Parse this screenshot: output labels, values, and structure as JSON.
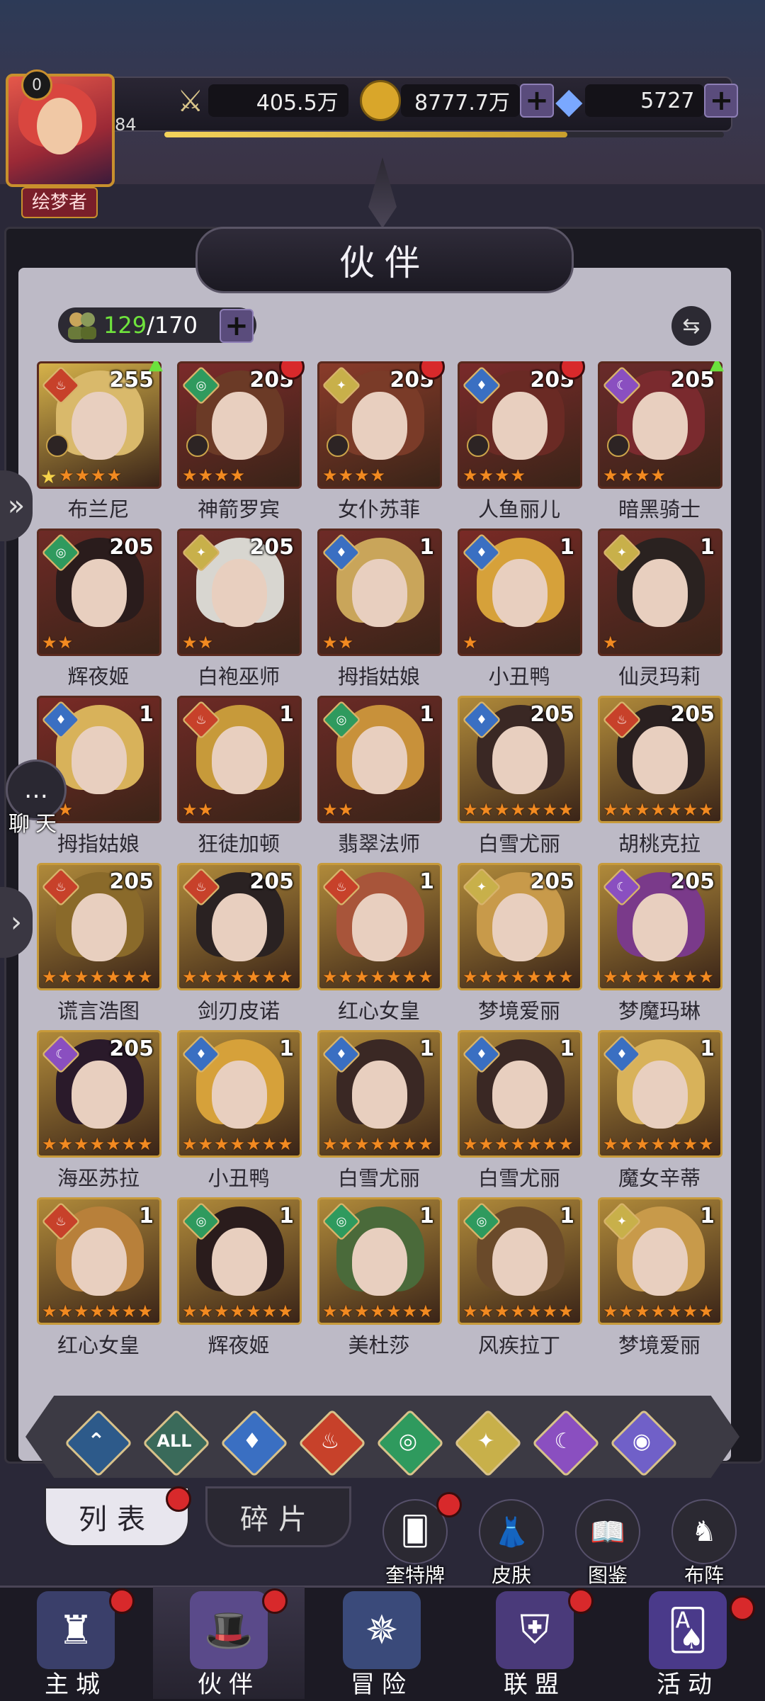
{
  "header": {
    "player_level": "84",
    "vip_level": "0",
    "player_title": "绘梦者",
    "power": "405.5万",
    "gold": "8777.7万",
    "diamonds": "5727",
    "xp_fill_fraction": 0.72
  },
  "panel": {
    "title": "伙伴",
    "count_current": "129",
    "count_total": "/170"
  },
  "heroes": [
    {
      "name": "布兰尼",
      "level": "255",
      "element": "fire",
      "stars": 4,
      "badge": "arrow",
      "lock": true,
      "ystar": true,
      "bg": "#d6b24a",
      "hair": "#d9b96b"
    },
    {
      "name": "神箭罗宾",
      "level": "205",
      "element": "wind",
      "stars": 4,
      "badge": "dot",
      "lock": true,
      "bg": "#7b2a2a",
      "hair": "#6b3a26"
    },
    {
      "name": "女仆苏菲",
      "level": "205",
      "element": "light",
      "stars": 4,
      "badge": "dot",
      "lock": true,
      "bg": "#8a3b2a",
      "hair": "#7a3b28"
    },
    {
      "name": "人鱼丽儿",
      "level": "205",
      "element": "water",
      "stars": 4,
      "badge": "dot",
      "lock": true,
      "bg": "#7a2a2a",
      "hair": "#6a2a24"
    },
    {
      "name": "暗黑骑士",
      "level": "205",
      "element": "dark",
      "stars": 4,
      "badge": "arrow",
      "lock": true,
      "bg": "#6a2a2a",
      "hair": "#7a2a2e"
    },
    {
      "name": "辉夜姬",
      "level": "205",
      "element": "wind",
      "stars": 2,
      "bg": "#6e2a26",
      "hair": "#2a1c1c"
    },
    {
      "name": "白袍巫师",
      "level": "205",
      "element": "light",
      "stars": 2,
      "bg": "#6b2a26",
      "hair": "#d8d6d0"
    },
    {
      "name": "拇指姑娘",
      "level": "1",
      "element": "water",
      "stars": 2,
      "bg": "#6e2a26",
      "hair": "#c9a55a"
    },
    {
      "name": "小丑鸭",
      "level": "1",
      "element": "water",
      "stars": 1,
      "bg": "#7a2a26",
      "hair": "#d6a13a"
    },
    {
      "name": "仙灵玛莉",
      "level": "1",
      "element": "light",
      "stars": 1,
      "bg": "#6b2a26",
      "hair": "#2a2220"
    },
    {
      "name": "拇指姑娘",
      "level": "1",
      "element": "water",
      "stars": 2,
      "bg": "#7a2a26",
      "hair": "#d8b25a"
    },
    {
      "name": "狂徒加顿",
      "level": "1",
      "element": "fire",
      "stars": 2,
      "bg": "#6e2a26",
      "hair": "#c79a3a"
    },
    {
      "name": "翡翠法师",
      "level": "1",
      "element": "wind",
      "stars": 2,
      "bg": "#6a2a26",
      "hair": "#c8913a"
    },
    {
      "name": "白雪尤丽",
      "level": "205",
      "element": "water",
      "stars": 7,
      "bg": "#b08a3a",
      "hair": "#3a2824"
    },
    {
      "name": "胡桃克拉",
      "level": "205",
      "element": "fire",
      "stars": 7,
      "bg": "#b08a3a",
      "hair": "#2a2020"
    },
    {
      "name": "谎言浩图",
      "level": "205",
      "element": "fire",
      "stars": 7,
      "bg": "#b08a3a",
      "hair": "#8a6a2a"
    },
    {
      "name": "剑刃皮诺",
      "level": "205",
      "element": "fire",
      "stars": 7,
      "bg": "#b08a3a",
      "hair": "#2a2222"
    },
    {
      "name": "红心女皇",
      "level": "1",
      "element": "fire",
      "stars": 7,
      "bg": "#b08a3a",
      "hair": "#a8553a"
    },
    {
      "name": "梦境爱丽",
      "level": "205",
      "element": "light",
      "stars": 7,
      "bg": "#b08a3a",
      "hair": "#c89a4a"
    },
    {
      "name": "梦魔玛琳",
      "level": "205",
      "element": "dark",
      "stars": 7,
      "bg": "#b08a3a",
      "hair": "#7a3a8a"
    },
    {
      "name": "海巫苏拉",
      "level": "205",
      "element": "dark",
      "stars": 7,
      "bg": "#b08a3a",
      "hair": "#2a1a2a"
    },
    {
      "name": "小丑鸭",
      "level": "1",
      "element": "water",
      "stars": 7,
      "bg": "#b08a3a",
      "hair": "#d6a13a"
    },
    {
      "name": "白雪尤丽",
      "level": "1",
      "element": "water",
      "stars": 7,
      "bg": "#b08a3a",
      "hair": "#3a2824"
    },
    {
      "name": "白雪尤丽",
      "level": "1",
      "element": "water",
      "stars": 7,
      "bg": "#b08a3a",
      "hair": "#3a2824"
    },
    {
      "name": "魔女辛蒂",
      "level": "1",
      "element": "water",
      "stars": 7,
      "bg": "#b08a3a",
      "hair": "#d8b25a"
    },
    {
      "name": "红心女皇",
      "level": "1",
      "element": "fire",
      "stars": 7,
      "bg": "#b08a3a",
      "hair": "#b8803a"
    },
    {
      "name": "辉夜姬",
      "level": "1",
      "element": "wind",
      "stars": 7,
      "bg": "#b08a3a",
      "hair": "#2a1c1c"
    },
    {
      "name": "美杜莎",
      "level": "1",
      "element": "wind",
      "stars": 7,
      "bg": "#b08a3a",
      "hair": "#4a6a3a"
    },
    {
      "name": "风疾拉丁",
      "level": "1",
      "element": "wind",
      "stars": 7,
      "bg": "#b08a3a",
      "hair": "#6a4a2a"
    },
    {
      "name": "梦境爱丽",
      "level": "1",
      "element": "light",
      "stars": 7,
      "bg": "#b08a3a",
      "hair": "#c89a4a"
    }
  ],
  "element_colors": {
    "fire": "#c7412a",
    "water": "#3a6fc2",
    "wind": "#2f9a5e",
    "light": "#c8b04a",
    "dark": "#8a4fc0",
    "all": "#3a6a5a",
    "star": "#7060c8",
    "void": "#2d5a8a"
  },
  "element_glyphs": {
    "fire": "♨",
    "water": "♦",
    "wind": "◎",
    "light": "✦",
    "dark": "☾"
  },
  "filters": [
    {
      "id": "void",
      "glyph": "⌃"
    },
    {
      "id": "all",
      "glyph": "ALL"
    },
    {
      "id": "water",
      "glyph": "♦"
    },
    {
      "id": "fire",
      "glyph": "♨"
    },
    {
      "id": "wind",
      "glyph": "◎"
    },
    {
      "id": "light",
      "glyph": "✦"
    },
    {
      "id": "dark",
      "glyph": "☾"
    },
    {
      "id": "star",
      "glyph": "◉"
    }
  ],
  "tabs": {
    "list": "列表",
    "fragments": "碎片"
  },
  "quick": {
    "tarot": "奎特牌",
    "skin": "皮肤",
    "codex": "图鉴",
    "formation": "布阵"
  },
  "nav": {
    "city": "主城",
    "partner": "伙伴",
    "adventure": "冒险",
    "alliance": "联盟",
    "event": "活动"
  },
  "chat": {
    "label": "聊天",
    "icon": "chat-bubble-icon"
  }
}
